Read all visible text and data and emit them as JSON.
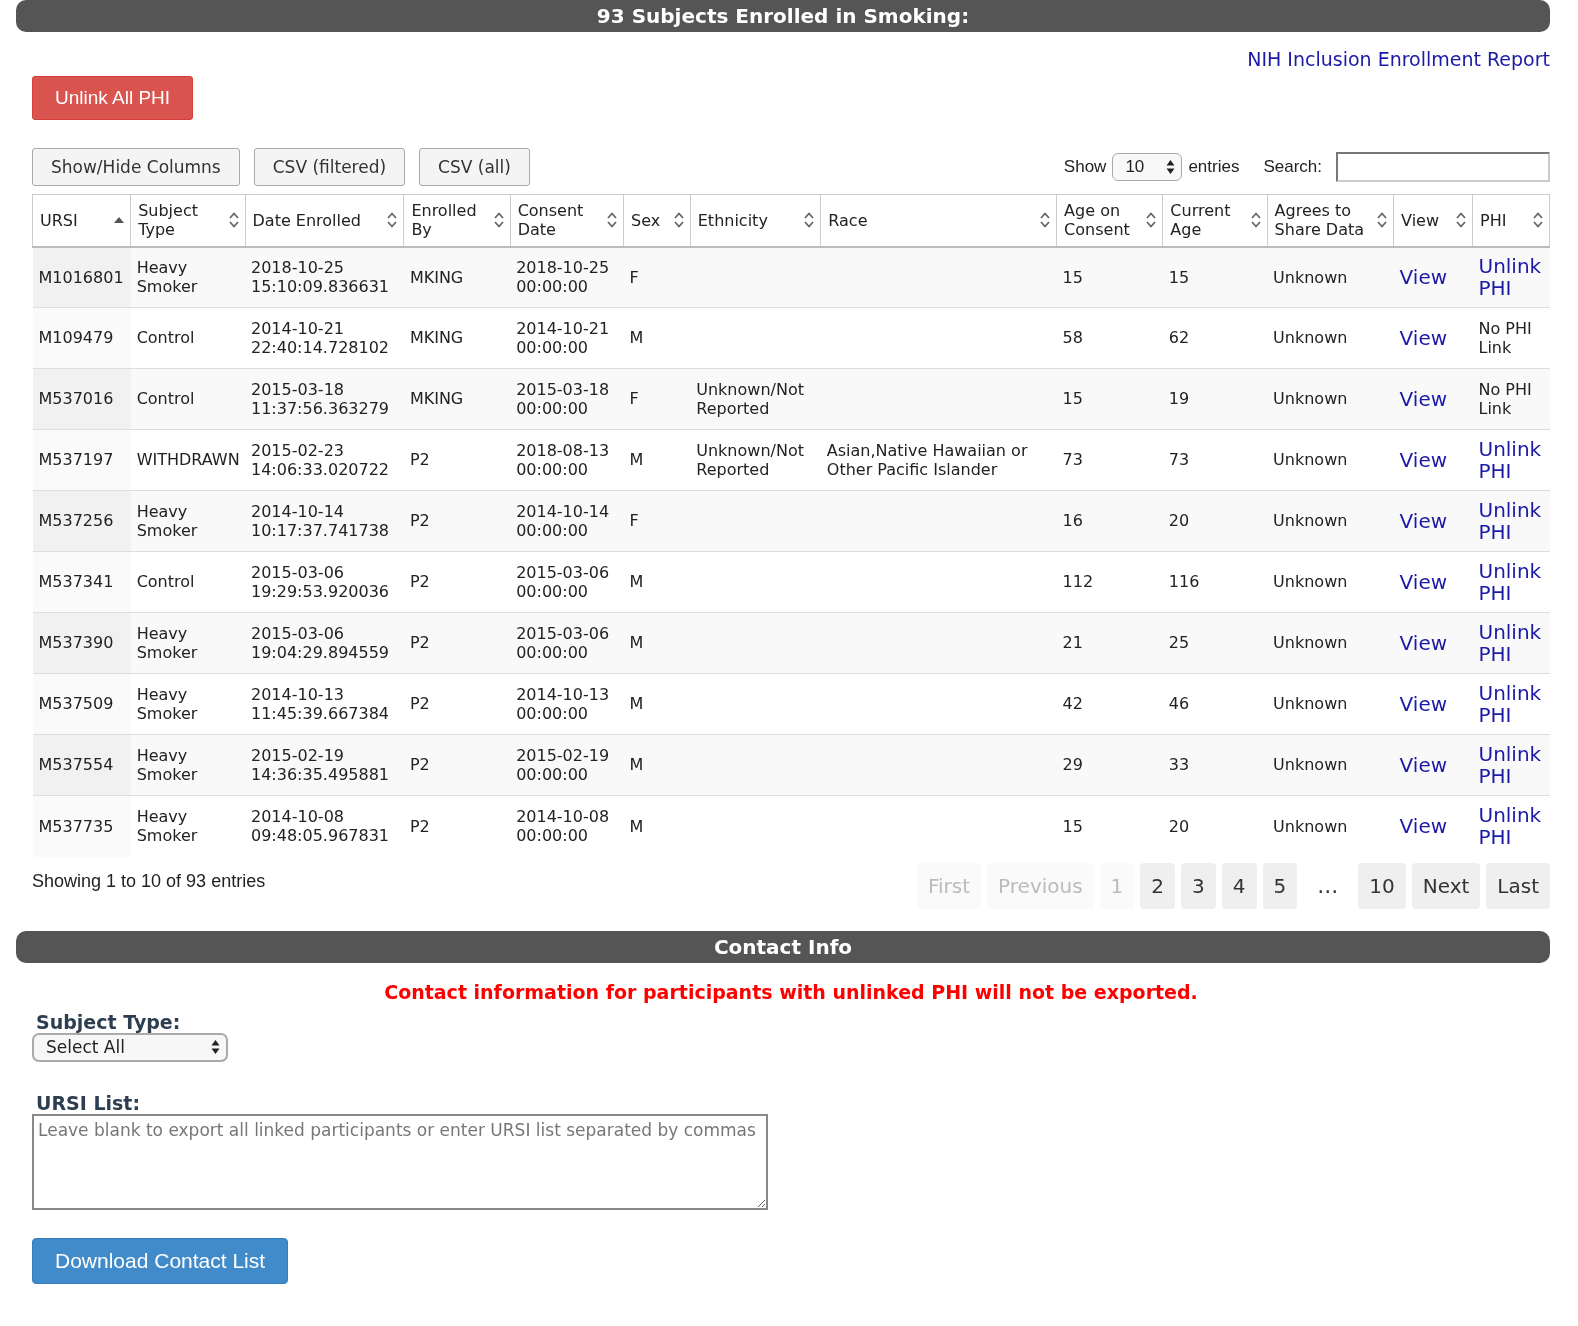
{
  "header": {
    "title": "93 Subjects Enrolled in Smoking:"
  },
  "report_link": "NIH Inclusion Enrollment Report",
  "unlink_all_button": "Unlink All PHI",
  "toolbar_buttons": [
    "Show/Hide Columns",
    "CSV (filtered)",
    "CSV (all)"
  ],
  "length": {
    "before": "Show",
    "value": "10",
    "after": "entries"
  },
  "search": {
    "label": "Search:"
  },
  "table": {
    "columns": [
      {
        "label": "URSI",
        "sorted": true
      },
      {
        "label": "Subject Type",
        "sorted": false
      },
      {
        "label": "Date Enrolled",
        "sorted": false
      },
      {
        "label": "Enrolled By",
        "sorted": false
      },
      {
        "label": "Consent Date",
        "sorted": false
      },
      {
        "label": "Sex",
        "sorted": false
      },
      {
        "label": "Ethnicity",
        "sorted": false
      },
      {
        "label": "Race",
        "sorted": false
      },
      {
        "label": "Age on Consent",
        "sorted": false
      },
      {
        "label": "Current Age",
        "sorted": false
      },
      {
        "label": "Agrees to Share Data",
        "sorted": false
      },
      {
        "label": "View",
        "sorted": false
      },
      {
        "label": "PHI",
        "sorted": false
      }
    ],
    "rows": [
      {
        "cells": [
          "M1016801",
          "Heavy Smoker",
          "2018-10-25 15:10:09.836631",
          "MKING",
          "2018-10-25 00:00:00",
          "F",
          "",
          "",
          "15",
          "15",
          "Unknown"
        ],
        "view": "View",
        "phi": {
          "kind": "link",
          "text": "Unlink PHI"
        }
      },
      {
        "cells": [
          "M109479",
          "Control",
          "2014-10-21 22:40:14.728102",
          "MKING",
          "2014-10-21 00:00:00",
          "M",
          "",
          "",
          "58",
          "62",
          "Unknown"
        ],
        "view": "View",
        "phi": {
          "kind": "text",
          "text": "No PHI Link"
        }
      },
      {
        "cells": [
          "M537016",
          "Control",
          "2015-03-18 11:37:56.363279",
          "MKING",
          "2015-03-18 00:00:00",
          "F",
          "Unknown/Not Reported",
          "",
          "15",
          "19",
          "Unknown"
        ],
        "view": "View",
        "phi": {
          "kind": "text",
          "text": "No PHI Link"
        }
      },
      {
        "cells": [
          "M537197",
          "WITHDRAWN",
          "2015-02-23 14:06:33.020722",
          "P2",
          "2018-08-13 00:00:00",
          "M",
          "Unknown/Not Reported",
          "Asian,Native Hawaiian or Other Pacific Islander",
          "73",
          "73",
          "Unknown"
        ],
        "view": "View",
        "phi": {
          "kind": "link",
          "text": "Unlink PHI"
        }
      },
      {
        "cells": [
          "M537256",
          "Heavy Smoker",
          "2014-10-14 10:17:37.741738",
          "P2",
          "2014-10-14 00:00:00",
          "F",
          "",
          "",
          "16",
          "20",
          "Unknown"
        ],
        "view": "View",
        "phi": {
          "kind": "link",
          "text": "Unlink PHI"
        }
      },
      {
        "cells": [
          "M537341",
          "Control",
          "2015-03-06 19:29:53.920036",
          "P2",
          "2015-03-06 00:00:00",
          "M",
          "",
          "",
          "112",
          "116",
          "Unknown"
        ],
        "view": "View",
        "phi": {
          "kind": "link",
          "text": "Unlink PHI"
        }
      },
      {
        "cells": [
          "M537390",
          "Heavy Smoker",
          "2015-03-06 19:04:29.894559",
          "P2",
          "2015-03-06 00:00:00",
          "M",
          "",
          "",
          "21",
          "25",
          "Unknown"
        ],
        "view": "View",
        "phi": {
          "kind": "link",
          "text": "Unlink PHI"
        }
      },
      {
        "cells": [
          "M537509",
          "Heavy Smoker",
          "2014-10-13 11:45:39.667384",
          "P2",
          "2014-10-13 00:00:00",
          "M",
          "",
          "",
          "42",
          "46",
          "Unknown"
        ],
        "view": "View",
        "phi": {
          "kind": "link",
          "text": "Unlink PHI"
        }
      },
      {
        "cells": [
          "M537554",
          "Heavy Smoker",
          "2015-02-19 14:36:35.495881",
          "P2",
          "2015-02-19 00:00:00",
          "M",
          "",
          "",
          "29",
          "33",
          "Unknown"
        ],
        "view": "View",
        "phi": {
          "kind": "link",
          "text": "Unlink PHI"
        }
      },
      {
        "cells": [
          "M537735",
          "Heavy Smoker",
          "2014-10-08 09:48:05.967831",
          "P2",
          "2014-10-08 00:00:00",
          "M",
          "",
          "",
          "15",
          "20",
          "Unknown"
        ],
        "view": "View",
        "phi": {
          "kind": "link",
          "text": "Unlink PHI"
        }
      }
    ]
  },
  "info": "Showing 1 to 10 of 93 entries",
  "pagination": [
    {
      "kind": "page",
      "label": "First",
      "disabled": true
    },
    {
      "kind": "page",
      "label": "Previous",
      "disabled": true
    },
    {
      "kind": "page",
      "label": "1",
      "disabled": true
    },
    {
      "kind": "page",
      "label": "2",
      "disabled": false
    },
    {
      "kind": "page",
      "label": "3",
      "disabled": false
    },
    {
      "kind": "page",
      "label": "4",
      "disabled": false
    },
    {
      "kind": "page",
      "label": "5",
      "disabled": false
    },
    {
      "kind": "gap",
      "label": "…"
    },
    {
      "kind": "page",
      "label": "10",
      "disabled": false
    },
    {
      "kind": "page",
      "label": "Next",
      "disabled": false
    },
    {
      "kind": "page",
      "label": "Last",
      "disabled": false
    }
  ],
  "contact": {
    "title": "Contact Info",
    "warning": "Contact information for participants with unlinked PHI will not be exported.",
    "subject_type_label": "Subject Type:",
    "subject_type_value": "Select All",
    "ursi_label": "URSI List:",
    "ursi_placeholder": "Leave blank to export all linked participants or enter URSI list separated by commas",
    "download_button": "Download Contact List"
  }
}
